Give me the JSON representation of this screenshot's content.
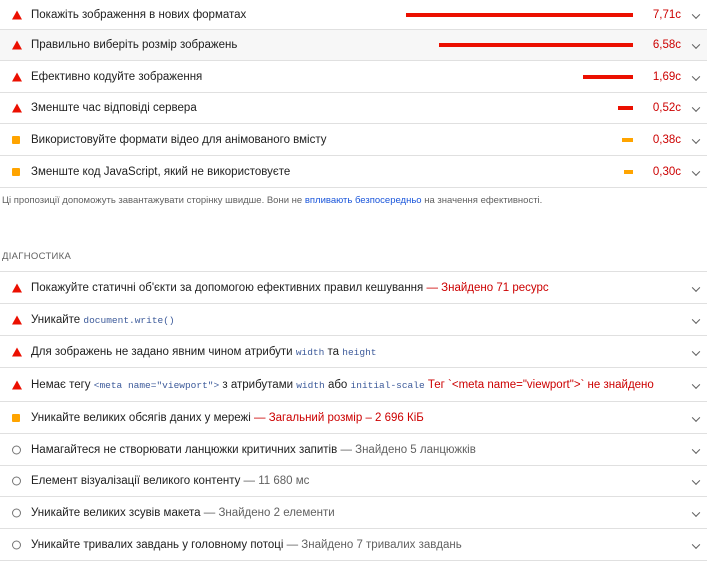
{
  "opportunities": [
    {
      "title": "Покажіть зображення в нових форматах",
      "value": "7,71с",
      "status": "fail",
      "bar": 0.97
    },
    {
      "title": "Правильно виберіть розмір зображень",
      "value": "6,58с",
      "status": "fail",
      "bar": 0.83
    },
    {
      "title": "Ефективно кодуйте зображення",
      "value": "1,69с",
      "status": "fail",
      "bar": 0.21
    },
    {
      "title": "Зменште час відповіді сервера",
      "value": "0,52с",
      "status": "fail",
      "bar": 0.06
    },
    {
      "title": "Використовуйте формати відео для анімованого вмісту",
      "value": "0,38с",
      "status": "average",
      "bar": 0.04
    },
    {
      "title": "Зменште код JavaScript, який не використовуєте",
      "value": "0,30с",
      "status": "average",
      "bar": 0.03
    }
  ],
  "note": {
    "before": "Ці пропозиції допоможуть завантажувати сторінку швидше. Вони не ",
    "link": "впливають безпосередньо",
    "after": " на значення ефективності."
  },
  "diagnostics_heading": "ДІАГНОСТИКА",
  "diagnostics": [
    {
      "title": "Покажуйте статичні об'єкти за допомогою ефективних правил кешування",
      "display": "— Знайдено 71 ресурс"
    },
    {
      "title": "Уникайте",
      "code": "document.write()"
    },
    {
      "t1": "Для зображень не задано явним чином атрибути",
      "c1": "width",
      "t2": "та",
      "c2": "height"
    },
    {
      "t1": "Немає тегу",
      "c1": "<meta name=\"viewport\">",
      "t2": "з атрибутами",
      "c2": "width",
      "t3": "або",
      "c3": "initial-scale",
      "display": "Тег `<meta name=\"viewport\">` не знайдено"
    },
    {
      "title": "Уникайте великих обсягів даних у мережі",
      "display": "— Загальний розмір – 2 696 КіБ"
    },
    {
      "title": "Намагайтеся не створювати ланцюжки критичних запитів",
      "display": "— Знайдено 5 ланцюжків"
    },
    {
      "title": "Елемент візуалізації великого контенту",
      "display": "— 11 680 мс"
    },
    {
      "title": "Уникайте великих зсувів макета",
      "display": "— Знайдено 2 елементи"
    },
    {
      "title": "Уникайте тривалих завдань у головному потоці",
      "display": "— Знайдено 7 тривалих завдань"
    }
  ],
  "colors": {
    "fail": "#eb0f00",
    "average": "#ffa400",
    "value": "#cc0000",
    "link": "#1a56db"
  }
}
